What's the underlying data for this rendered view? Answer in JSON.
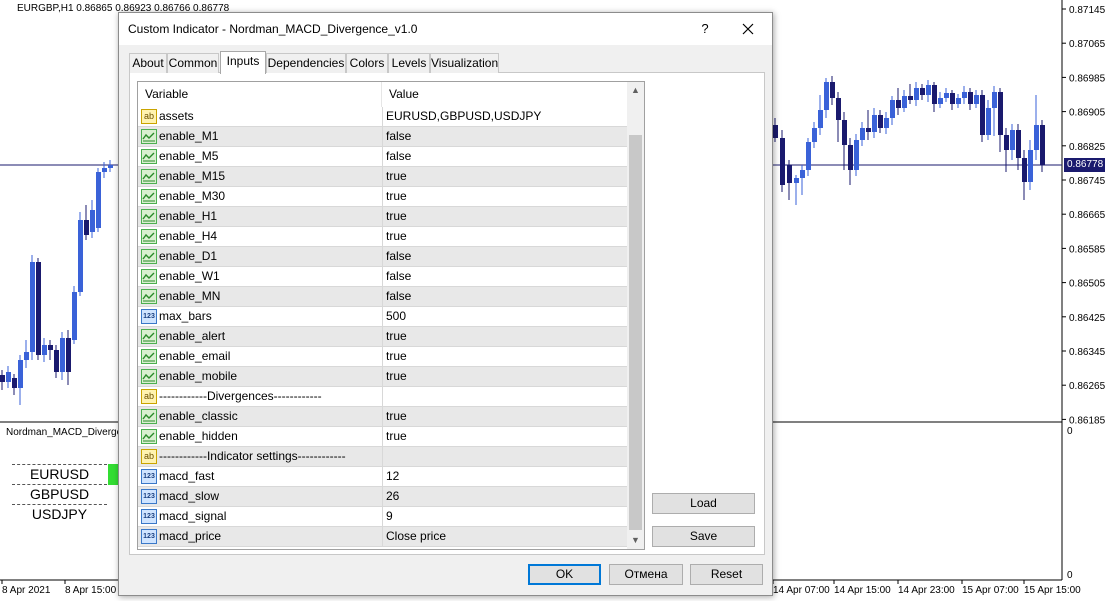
{
  "chart": {
    "symbol_header": "EURGBP,H1  0.86865 0.86923 0.86766 0.86778",
    "current_price": "0.86778",
    "indicator_window_label": "Nordman_MACD_Divergen",
    "price_ticks": [
      "0.87145",
      "0.87065",
      "0.86985",
      "0.86905",
      "0.86825",
      "0.86745",
      "0.86665",
      "0.86585",
      "0.86505",
      "0.86425",
      "0.86345",
      "0.86265",
      "0.86185"
    ],
    "indicator_ticks": [
      "0",
      "0"
    ],
    "time_labels": [
      "8 Apr 2021",
      "8 Apr 15:00",
      "14 Apr 07:00",
      "14 Apr 15:00",
      "14 Apr 23:00",
      "15 Apr 07:00",
      "15 Apr 15:00"
    ],
    "pairs": [
      "EURUSD",
      "GBPUSD",
      "USDJPY"
    ],
    "colors": {
      "bull": "#3a62d8",
      "bear": "#1a1a6e",
      "price_line": "#1a1a6e",
      "indicator_box": "#33dd33"
    }
  },
  "dialog": {
    "title": "Custom Indicator - Nordman_MACD_Divergence_v1.0",
    "help_label": "?",
    "close_icon": "close-icon",
    "tabs": [
      "About",
      "Common",
      "Inputs",
      "Dependencies",
      "Colors",
      "Levels",
      "Visualization"
    ],
    "active_tab": "Inputs",
    "grid": {
      "headers": {
        "variable": "Variable",
        "value": "Value"
      },
      "rows": [
        {
          "type": "string",
          "icon_text": "ab",
          "name": "assets",
          "value": "EURUSD,GBPUSD,USDJPY"
        },
        {
          "type": "bool",
          "icon_text": "",
          "name": "enable_M1",
          "value": "false"
        },
        {
          "type": "bool",
          "icon_text": "",
          "name": "enable_M5",
          "value": "false"
        },
        {
          "type": "bool",
          "icon_text": "",
          "name": "enable_M15",
          "value": "true"
        },
        {
          "type": "bool",
          "icon_text": "",
          "name": "enable_M30",
          "value": "true"
        },
        {
          "type": "bool",
          "icon_text": "",
          "name": "enable_H1",
          "value": "true"
        },
        {
          "type": "bool",
          "icon_text": "",
          "name": "enable_H4",
          "value": "true"
        },
        {
          "type": "bool",
          "icon_text": "",
          "name": "enable_D1",
          "value": "false"
        },
        {
          "type": "bool",
          "icon_text": "",
          "name": "enable_W1",
          "value": "false"
        },
        {
          "type": "bool",
          "icon_text": "",
          "name": "enable_MN",
          "value": "false"
        },
        {
          "type": "int",
          "icon_text": "123",
          "name": "max_bars",
          "value": "500"
        },
        {
          "type": "bool",
          "icon_text": "",
          "name": "enable_alert",
          "value": "true"
        },
        {
          "type": "bool",
          "icon_text": "",
          "name": "enable_email",
          "value": "true"
        },
        {
          "type": "bool",
          "icon_text": "",
          "name": "enable_mobile",
          "value": "true"
        },
        {
          "type": "string",
          "icon_text": "ab",
          "name": "------------Divergences------------",
          "value": ""
        },
        {
          "type": "bool",
          "icon_text": "",
          "name": "enable_classic",
          "value": "true"
        },
        {
          "type": "bool",
          "icon_text": "",
          "name": "enable_hidden",
          "value": "true"
        },
        {
          "type": "string",
          "icon_text": "ab",
          "name": "------------Indicator settings------------",
          "value": ""
        },
        {
          "type": "int",
          "icon_text": "123",
          "name": "macd_fast",
          "value": "12"
        },
        {
          "type": "int",
          "icon_text": "123",
          "name": "macd_slow",
          "value": "26"
        },
        {
          "type": "int",
          "icon_text": "123",
          "name": "macd_signal",
          "value": "9"
        },
        {
          "type": "int",
          "icon_text": "123",
          "name": "macd_price",
          "value": "Close price"
        }
      ]
    },
    "buttons": {
      "load": "Load",
      "save": "Save",
      "ok": "OK",
      "cancel": "Отмена",
      "reset": "Reset"
    }
  }
}
